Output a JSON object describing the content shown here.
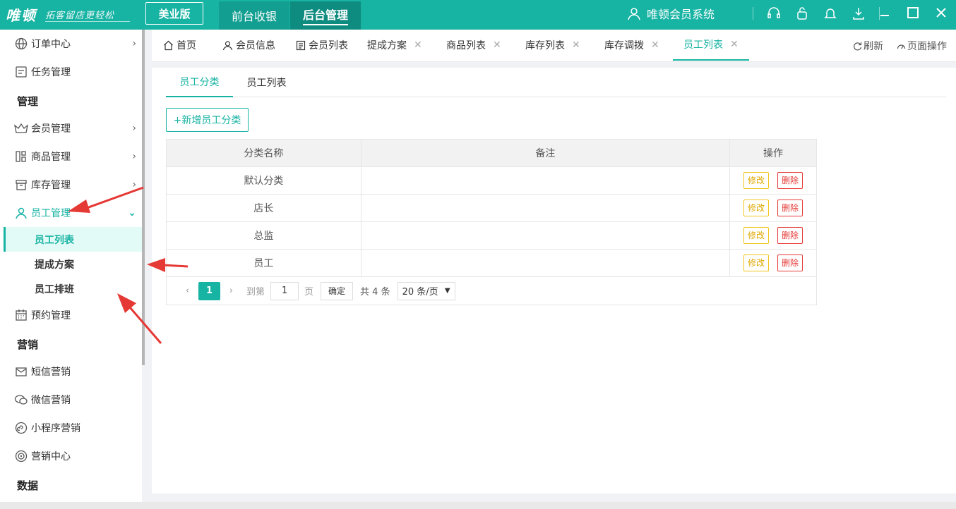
{
  "topbar": {
    "logo": "唯顿",
    "slogan": "拓客留店更轻松",
    "edition": "美业版",
    "mode_front": "前台收银",
    "mode_back": "后台管理",
    "system_name": "唯顿会员系统",
    "icons": [
      "user-icon",
      "headset-icon",
      "lock-icon",
      "bell-icon",
      "download-icon"
    ],
    "window_controls": [
      "minimize-icon",
      "maximize-icon",
      "close-icon"
    ]
  },
  "sidebar": {
    "items": [
      {
        "label": "订单中心",
        "icon": "globe-icon"
      },
      {
        "label": "任务管理",
        "icon": "task-icon"
      },
      {
        "section": "管理"
      },
      {
        "label": "会员管理",
        "icon": "crown-icon"
      },
      {
        "label": "商品管理",
        "icon": "grid-icon"
      },
      {
        "label": "库存管理",
        "icon": "box-icon"
      },
      {
        "label": "员工管理",
        "icon": "user-icon"
      },
      {
        "label": "员工列表"
      },
      {
        "label": "提成方案"
      },
      {
        "label": "员工排班"
      },
      {
        "label": "预约管理",
        "icon": "calendar-icon"
      },
      {
        "section": "营销"
      },
      {
        "label": "短信营销",
        "icon": "mail-icon"
      },
      {
        "label": "微信营销",
        "icon": "wechat-icon"
      },
      {
        "label": "小程序营销",
        "icon": "miniapp-icon"
      },
      {
        "label": "营销中心",
        "icon": "target-icon"
      },
      {
        "section": "数据"
      }
    ]
  },
  "tabs": {
    "items": [
      "首页",
      "会员信息",
      "会员列表",
      "提成方案",
      "商品列表",
      "库存列表",
      "库存调拨",
      "员工列表"
    ],
    "active": "员工列表",
    "refresh": "刷新",
    "page_ops": "页面操作"
  },
  "content": {
    "subtabs": [
      "员工分类",
      "员工列表"
    ],
    "add_button": "+新增员工分类",
    "table": {
      "headers": [
        "分类名称",
        "备注",
        "操作"
      ],
      "rows": [
        {
          "name": "默认分类",
          "note": ""
        },
        {
          "name": "店长",
          "note": ""
        },
        {
          "name": "总监",
          "note": ""
        },
        {
          "name": "员工",
          "note": ""
        }
      ],
      "edit_label": "修改",
      "delete_label": "删除"
    },
    "pager": {
      "current_page": "1",
      "goto_label": "到第",
      "goto_value": "1",
      "page_unit": "页",
      "confirm": "确定",
      "total": "共 4 条",
      "page_size": "20 条/页"
    }
  },
  "colors": {
    "brand": "#17b3a3",
    "edit": "#e0a800",
    "delete": "#e53935",
    "arrow": "#e53935"
  }
}
